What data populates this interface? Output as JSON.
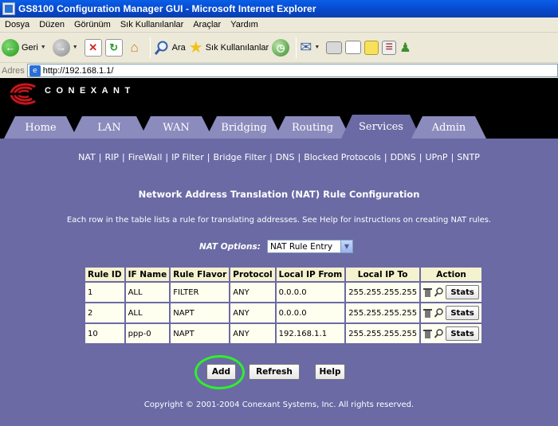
{
  "window": {
    "title": "GS8100 Configuration Manager GUI - Microsoft Internet Explorer"
  },
  "menu": [
    "Dosya",
    "Düzen",
    "Görünüm",
    "Sık Kullanılanlar",
    "Araçlar",
    "Yardım"
  ],
  "toolbar": {
    "back_label": "Geri",
    "search_label": "Ara",
    "favorites_label": "Sık Kullanılanlar"
  },
  "address": {
    "label": "Adres",
    "url": "http://192.168.1.1/"
  },
  "brand": {
    "name": "CONEXANT"
  },
  "tabs": [
    "Home",
    "LAN",
    "WAN",
    "Bridging",
    "Routing",
    "Services",
    "Admin"
  ],
  "active_tab": "Services",
  "subnav": [
    "NAT",
    "RIP",
    "FireWall",
    "IP Filter",
    "Bridge Filter",
    "DNS",
    "Blocked Protocols",
    "DDNS",
    "UPnP",
    "SNTP"
  ],
  "page": {
    "title": "Network Address Translation (NAT) Rule Configuration",
    "description": "Each row in the table lists a rule for translating addresses. See Help for instructions on creating NAT rules.",
    "options_label": "NAT Options:",
    "options_value": "NAT Rule Entry"
  },
  "table": {
    "headers": [
      "Rule ID",
      "IF Name",
      "Rule Flavor",
      "Protocol",
      "Local IP From",
      "Local IP To",
      "Action"
    ],
    "rows": [
      [
        "1",
        "ALL",
        "FILTER",
        "ANY",
        "0.0.0.0",
        "255.255.255.255"
      ],
      [
        "2",
        "ALL",
        "NAPT",
        "ANY",
        "0.0.0.0",
        "255.255.255.255"
      ],
      [
        "10",
        "ppp-0",
        "NAPT",
        "ANY",
        "192.168.1.1",
        "255.255.255.255"
      ]
    ],
    "stats_label": "Stats"
  },
  "buttons": {
    "add": "Add",
    "refresh": "Refresh",
    "help": "Help"
  },
  "footer": "Copyright © 2001-2004 Conexant Systems, Inc. All rights reserved.",
  "colors": {
    "page_bg": "#6b6aa5",
    "tab_bg": "#8c8bbd",
    "highlight": "#2ef02b",
    "titlebar": "#0a5ee8"
  }
}
